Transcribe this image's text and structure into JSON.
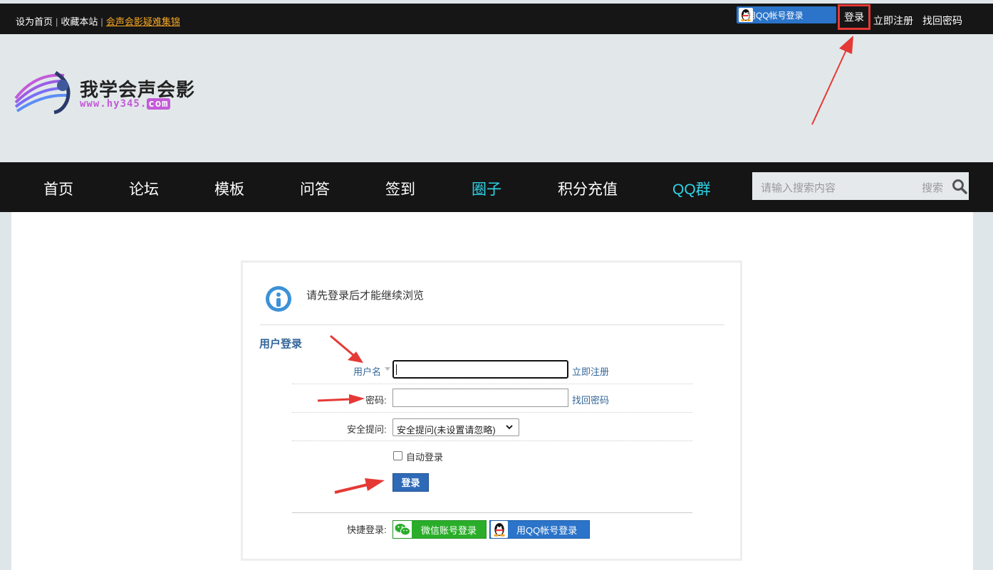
{
  "topbar": {
    "set_home": "设为首页",
    "sep1": "|",
    "bookmark": "收藏本站",
    "sep2": "|",
    "faq_link": "会声会影疑难集锦",
    "qq_login": "用QQ帐号登录",
    "login": "登录",
    "register": "立即注册",
    "find_password": "找回密码"
  },
  "logo": {
    "title": "我学会声会影",
    "url_prefix": "www.hy345.",
    "url_suffix": "com"
  },
  "nav": {
    "items": [
      "首页",
      "论坛",
      "模板",
      "问答",
      "签到",
      "圈子",
      "积分充值",
      "QQ群"
    ],
    "search_placeholder": "请输入搜索内容",
    "search_button": "搜索"
  },
  "login_box": {
    "message": "请先登录后才能继续浏览",
    "section_title": "用户登录",
    "username_label": "用户名",
    "username_value": "",
    "register_link": "立即注册",
    "password_label": "密码:",
    "password_value": "",
    "find_password_link": "找回密码",
    "security_label": "安全提问:",
    "security_selected": "安全提问(未设置请忽略)",
    "auto_login_label": "自动登录",
    "auto_login_checked": false,
    "login_button": "登录",
    "quick_login_label": "快捷登录:",
    "wechat_login": "微信账号登录",
    "qq_login": "用QQ帐号登录"
  },
  "colors": {
    "annotation_red": "#e53935",
    "accent_blue": "#336699",
    "nav_highlight": "#2fd3e6",
    "wechat_green": "#2aae2a",
    "qq_blue": "#2b74c9"
  }
}
